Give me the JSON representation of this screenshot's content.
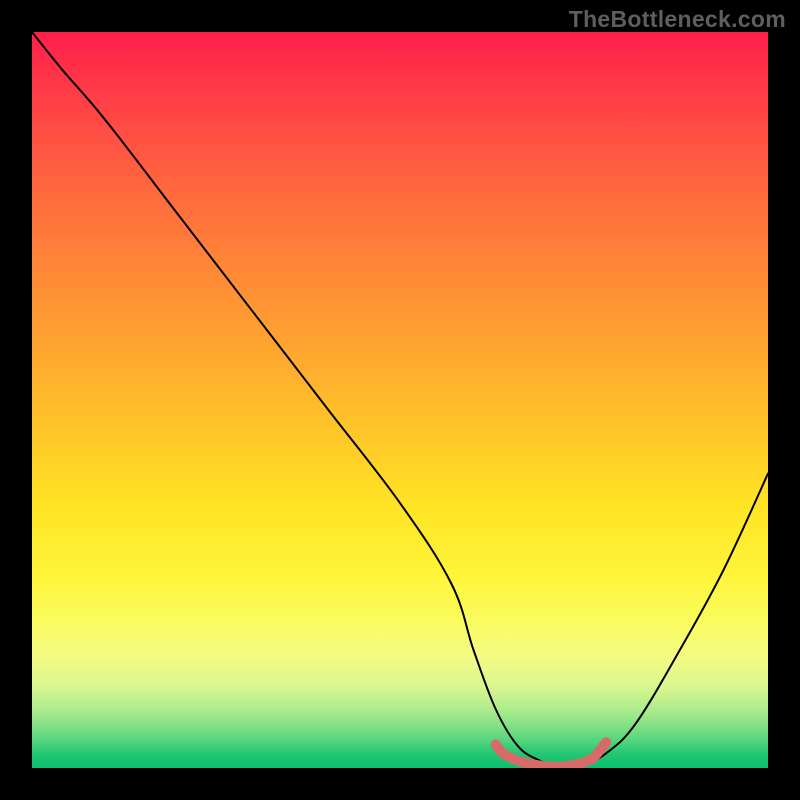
{
  "watermark": "TheBottleneck.com",
  "chart_data": {
    "type": "line",
    "title": "",
    "xlabel": "",
    "ylabel": "",
    "xlim": [
      0,
      100
    ],
    "ylim": [
      0,
      100
    ],
    "series": [
      {
        "name": "bottleneck-curve",
        "x": [
          0,
          4,
          10,
          20,
          30,
          40,
          50,
          57,
          60,
          63,
          66,
          69,
          72,
          75,
          78,
          82,
          88,
          94,
          100
        ],
        "values": [
          100,
          95,
          88,
          75,
          62,
          49,
          36,
          25,
          16,
          8,
          3,
          1,
          0,
          0.5,
          2,
          6,
          16,
          27,
          40
        ]
      },
      {
        "name": "optimal-range-marker",
        "x": [
          63,
          64,
          66,
          68,
          70,
          72,
          74,
          76,
          77,
          78
        ],
        "values": [
          3.2,
          2.0,
          1.0,
          0.5,
          0.2,
          0.2,
          0.5,
          1.2,
          2.2,
          3.5
        ]
      }
    ],
    "gradient_meaning": "top (red) = high bottleneck, bottom (green) = no bottleneck",
    "marker_color": "#d96a6a",
    "curve_color": "#000000"
  }
}
